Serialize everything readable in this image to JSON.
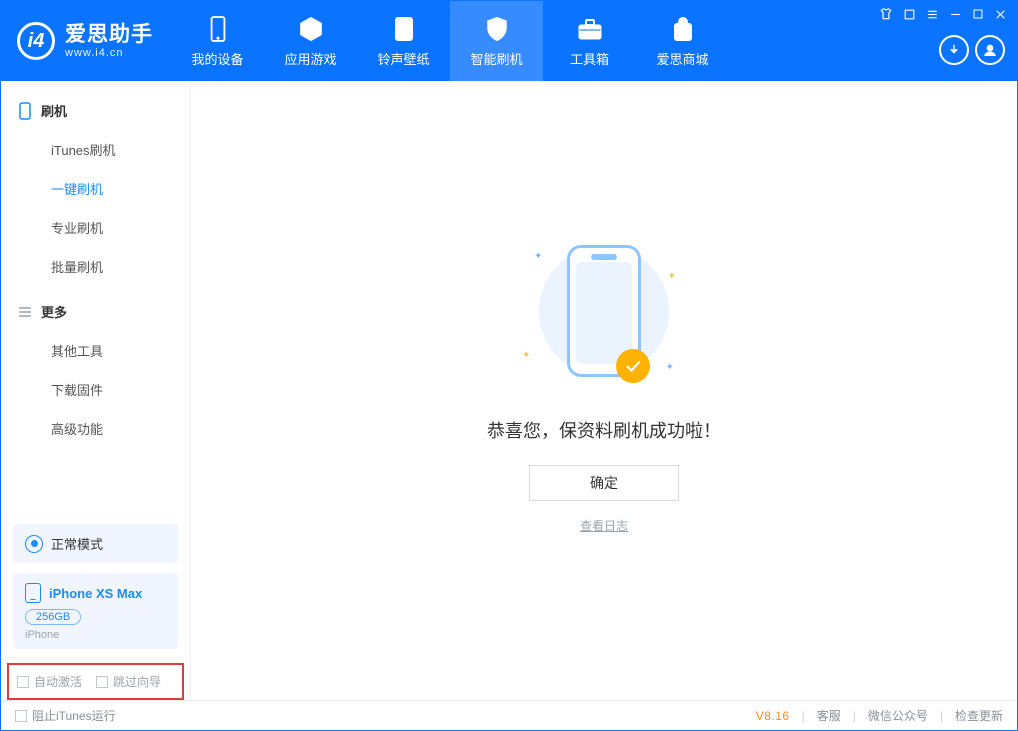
{
  "app": {
    "logo_title": "爱思助手",
    "logo_sub": "www.i4.cn"
  },
  "nav": {
    "items": [
      {
        "label": "我的设备"
      },
      {
        "label": "应用游戏"
      },
      {
        "label": "铃声壁纸"
      },
      {
        "label": "智能刷机"
      },
      {
        "label": "工具箱"
      },
      {
        "label": "爱思商城"
      }
    ]
  },
  "sidebar": {
    "section1": {
      "title": "刷机",
      "items": [
        {
          "label": "iTunes刷机"
        },
        {
          "label": "一键刷机"
        },
        {
          "label": "专业刷机"
        },
        {
          "label": "批量刷机"
        }
      ]
    },
    "section2": {
      "title": "更多",
      "items": [
        {
          "label": "其他工具"
        },
        {
          "label": "下载固件"
        },
        {
          "label": "高级功能"
        }
      ]
    },
    "mode_label": "正常模式",
    "device": {
      "name": "iPhone XS Max",
      "storage": "256GB",
      "type": "iPhone"
    },
    "options": {
      "auto_activate": "自动激活",
      "skip_guide": "跳过向导"
    }
  },
  "main": {
    "success_text": "恭喜您，保资料刷机成功啦！",
    "ok_button": "确定",
    "view_log": "查看日志"
  },
  "statusbar": {
    "block_itunes": "阻止iTunes运行",
    "version": "V8.16",
    "support": "客服",
    "wechat": "微信公众号",
    "check_update": "检查更新"
  }
}
